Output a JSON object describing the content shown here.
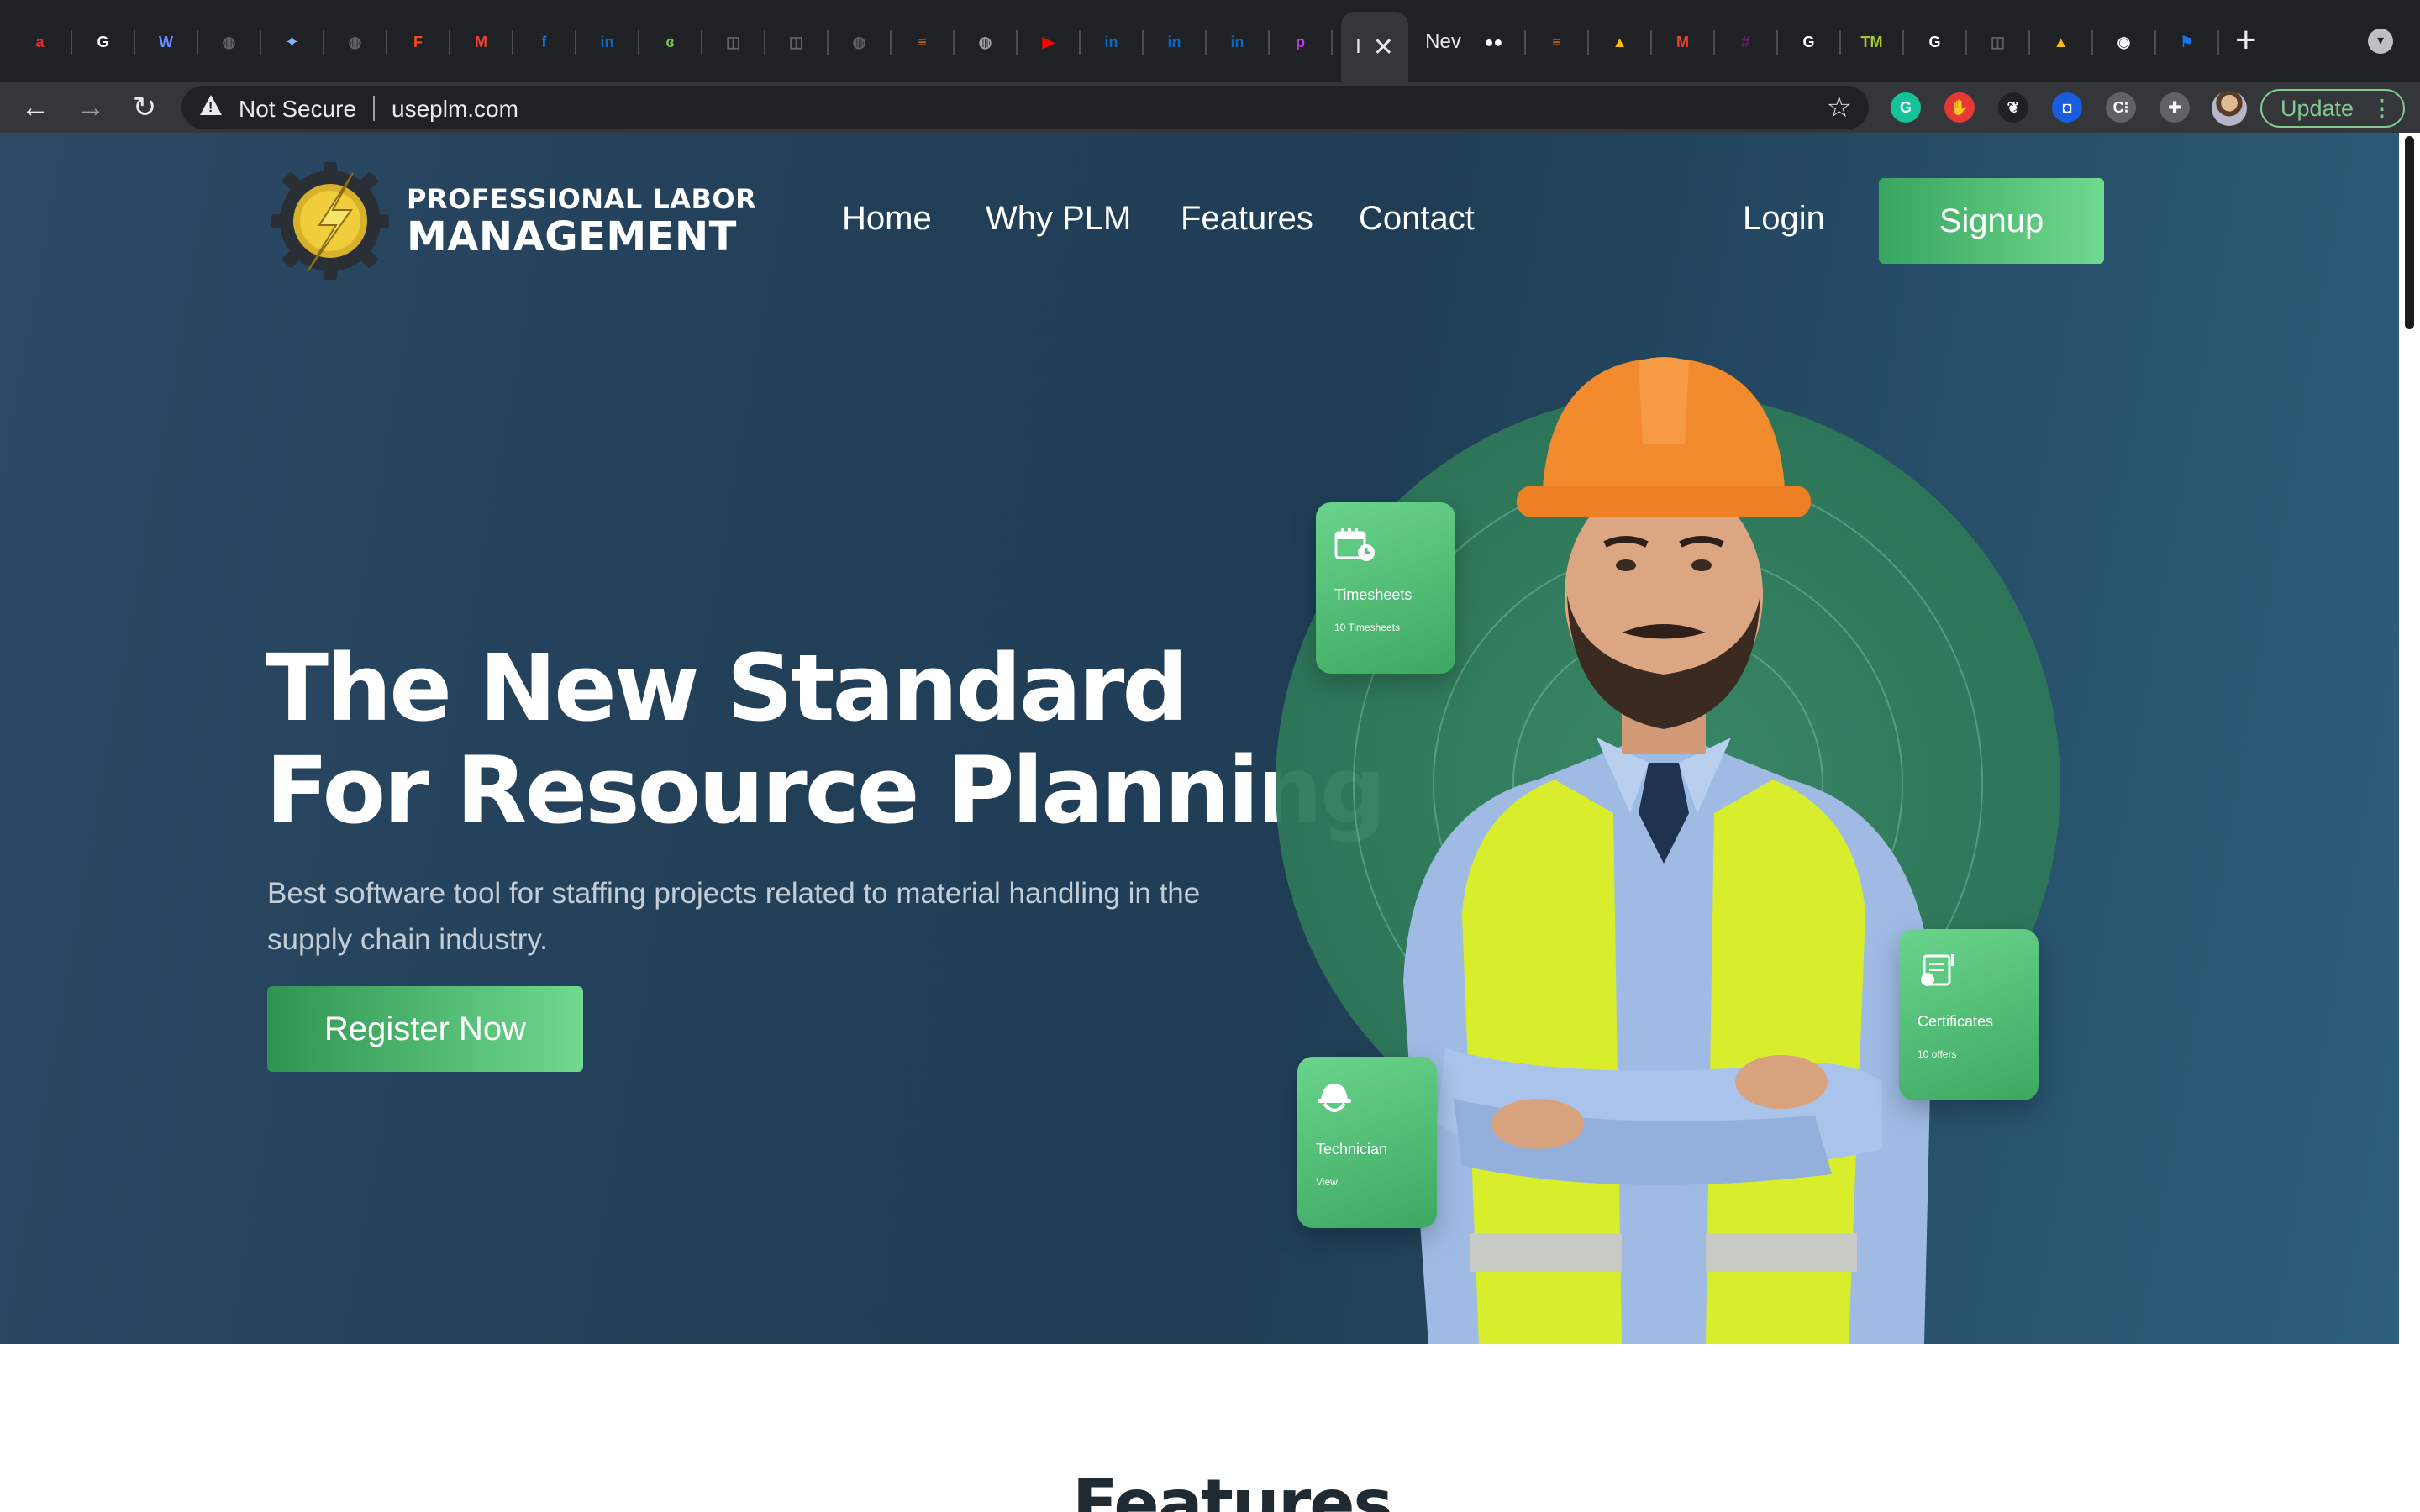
{
  "browser": {
    "tabs": [
      {
        "icon": "airtel-icon",
        "color": "#e62e2e",
        "glyph": "a"
      },
      {
        "icon": "google-icon",
        "color": "#ffffff",
        "glyph": "G"
      },
      {
        "icon": "lotus-icon",
        "color": "#6c8cff",
        "glyph": "W"
      },
      {
        "icon": "globe-icon",
        "color": "#5f6368",
        "glyph": "◍"
      },
      {
        "icon": "sparkle-icon",
        "color": "#8ab4f8",
        "glyph": "✦"
      },
      {
        "icon": "globe-icon",
        "color": "#5f6368",
        "glyph": "◍"
      },
      {
        "icon": "figma-icon",
        "color": "#f24e1e",
        "glyph": "F"
      },
      {
        "icon": "gmail-icon",
        "color": "#ea4335",
        "glyph": "M"
      },
      {
        "icon": "facebook-icon",
        "color": "#1877f2",
        "glyph": "f"
      },
      {
        "icon": "linkedin-icon",
        "color": "#0a66c2",
        "glyph": "in"
      },
      {
        "icon": "leaf-icon",
        "color": "#7ac943",
        "glyph": "ɞ"
      },
      {
        "icon": "camera-icon",
        "color": "#5f6368",
        "glyph": "◫"
      },
      {
        "icon": "camera-icon",
        "color": "#5f6368",
        "glyph": "◫"
      },
      {
        "icon": "globe-icon",
        "color": "#5f6368",
        "glyph": "◍"
      },
      {
        "icon": "stackoverflow-icon",
        "color": "#f48024",
        "glyph": "≡"
      },
      {
        "icon": "globe-icon",
        "color": "#9aa0a6",
        "glyph": "◍"
      },
      {
        "icon": "youtube-icon",
        "color": "#ff0000",
        "glyph": "▶"
      },
      {
        "icon": "linkedin-icon",
        "color": "#0a66c2",
        "glyph": "in"
      },
      {
        "icon": "linkedin-icon",
        "color": "#0a66c2",
        "glyph": "in"
      },
      {
        "icon": "linkedin-icon",
        "color": "#0a66c2",
        "glyph": "in"
      },
      {
        "icon": "picsart-icon",
        "color": "#c13df2",
        "glyph": "p"
      }
    ],
    "active_tab_text": "I",
    "next_tab_text": "Nev",
    "tabs_right": [
      {
        "icon": "medium-icon",
        "color": "#ffffff",
        "glyph": "●●"
      },
      {
        "icon": "stackoverflow-icon",
        "color": "#f48024",
        "glyph": "≡"
      },
      {
        "icon": "google-drive-icon",
        "color": "#fbbc04",
        "glyph": "▲"
      },
      {
        "icon": "gmail-icon",
        "color": "#ea4335",
        "glyph": "M"
      },
      {
        "icon": "slack-icon",
        "color": "#611f69",
        "glyph": "#"
      },
      {
        "icon": "google-icon",
        "color": "#ffffff",
        "glyph": "G"
      },
      {
        "icon": "tm-icon",
        "color": "#a4c639",
        "glyph": "TM"
      },
      {
        "icon": "google-icon",
        "color": "#ffffff",
        "glyph": "G"
      },
      {
        "icon": "camera-icon",
        "color": "#5f6368",
        "glyph": "◫"
      },
      {
        "icon": "google-drive-icon",
        "color": "#fbbc04",
        "glyph": "▲"
      },
      {
        "icon": "github-icon",
        "color": "#ffffff",
        "glyph": "◉"
      },
      {
        "icon": "flag-icon",
        "color": "#1a73e8",
        "glyph": "⚑"
      }
    ],
    "security_text": "Not Secure",
    "url": "useplm.com",
    "update_label": "Update",
    "extensions": [
      {
        "icon": "grammarly-icon",
        "color": "#15c39a",
        "glyph": "G"
      },
      {
        "icon": "stop-hand-icon",
        "color": "#e53935",
        "glyph": "✋"
      },
      {
        "icon": "paw-icon",
        "color": "#202124",
        "glyph": "❦"
      },
      {
        "icon": "bitwarden-icon",
        "color": "#175ddc",
        "glyph": "◘"
      },
      {
        "icon": "css-scan-icon",
        "color": "#5f6368",
        "glyph": "C⁝"
      },
      {
        "icon": "puzzle-icon",
        "color": "#5f6368",
        "glyph": "✚"
      }
    ]
  },
  "site": {
    "brand_line1": "PROFESSIONAL LABOR",
    "brand_line2": "MANAGEMENT",
    "nav": [
      "Home",
      "Why PLM",
      "Features",
      "Contact"
    ],
    "login": "Login",
    "signup": "Signup",
    "headline_line1": "The New Standard",
    "headline_line2": "For Resource Planning",
    "subline": "Best software tool for staffing projects related to material handling in the supply chain industry.",
    "register": "Register Now",
    "cards": [
      {
        "title": "Timesheets",
        "sub": "10 Timesheets",
        "icon": "calendar-icon"
      },
      {
        "title": "Certificates",
        "sub": "10 offers",
        "icon": "certificate-icon"
      },
      {
        "title": "Technician",
        "sub": "View",
        "icon": "hard-hat-icon"
      }
    ],
    "features_heading": "Features"
  },
  "colors": {
    "accent_green": "#4cbf73",
    "hero_bg": "#223f58",
    "hat_orange": "#f28a2e",
    "vest_yellow": "#d8ee2c"
  }
}
